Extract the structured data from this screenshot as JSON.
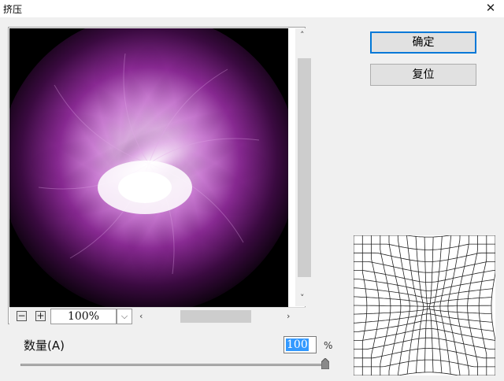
{
  "window": {
    "title": "挤压",
    "close_glyph": "✕"
  },
  "buttons": {
    "ok_label": "确定",
    "reset_label": "复位"
  },
  "preview": {
    "zoom_value": "100%",
    "zoom_out_glyph": "−",
    "zoom_in_glyph": "+",
    "dropdown_glyph": "⌵",
    "scroll_up_glyph": "˄",
    "scroll_down_glyph": "˅",
    "scroll_left_glyph": "‹",
    "scroll_right_glyph": "›"
  },
  "amount": {
    "label": "数量(A)",
    "value": "100",
    "unit": "%",
    "slider_fraction": 1.0
  },
  "colors": {
    "accent": "#0078d7",
    "preview_glow": "#b040c0"
  }
}
